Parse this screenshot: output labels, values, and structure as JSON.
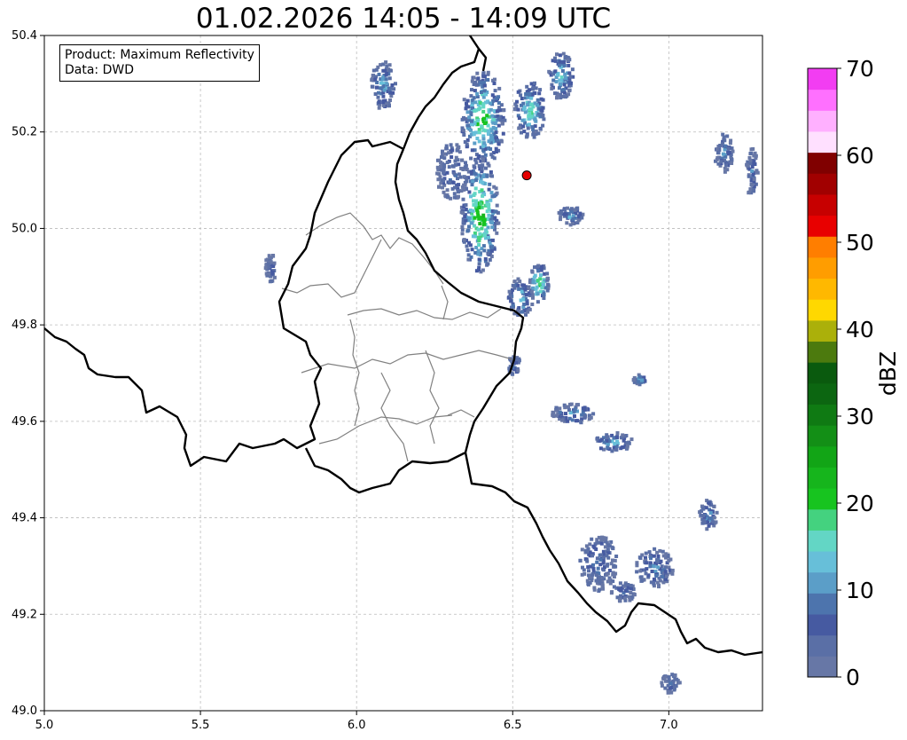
{
  "title": "01.02.2026 14:05 - 14:09 UTC",
  "info": {
    "product_line": "Product: Maximum Reflectivity",
    "data_line": "Data: DWD"
  },
  "map": {
    "lon_range": [
      5.0,
      7.3
    ],
    "lat_range": [
      49.0,
      50.4
    ],
    "x_ticks": [
      "5.0",
      "5.5",
      "6.0",
      "6.5",
      "7.0"
    ],
    "x_tick_values": [
      5.0,
      5.5,
      6.0,
      6.5,
      7.0
    ],
    "y_ticks": [
      "49.0",
      "49.2",
      "49.4",
      "49.6",
      "49.8",
      "50.0",
      "50.2",
      "50.4"
    ],
    "y_tick_values": [
      49.0,
      49.2,
      49.4,
      49.6,
      49.8,
      50.0,
      50.2,
      50.4
    ],
    "grid": true,
    "marker": {
      "lon": 6.545,
      "lat": 50.11,
      "color": "#e60000"
    },
    "border_color": "#000000",
    "district_color": "#808080",
    "gridline_color": "#bbbbbb"
  },
  "colorbar": {
    "label": "dBZ",
    "tick_labels": [
      "0",
      "10",
      "20",
      "30",
      "40",
      "50",
      "60",
      "70"
    ],
    "tick_values": [
      0,
      10,
      20,
      30,
      40,
      50,
      60,
      70
    ],
    "range": [
      0,
      70
    ],
    "colors": [
      "#6777a6",
      "#5a6fa6",
      "#465aa1",
      "#4d74ad",
      "#5b9ec8",
      "#67bfd9",
      "#63d6c5",
      "#44d27f",
      "#17c41f",
      "#16b51c",
      "#12a516",
      "#138f16",
      "#0f7a13",
      "#0c6611",
      "#0a5a0e",
      "#4c7a0e",
      "#abb00a",
      "#ffd800",
      "#ffb800",
      "#ff9d00",
      "#ff7e00",
      "#e80000",
      "#c70000",
      "#a10000",
      "#800000",
      "#ffe0ff",
      "#ffb0ff",
      "#ff70ff",
      "#f23df2"
    ]
  },
  "reflectivity_cells": [
    {
      "lon": 6.4,
      "lat": 50.23,
      "rx": 0.07,
      "ry": 0.1,
      "dbz": 22
    },
    {
      "lon": 6.39,
      "lat": 50.03,
      "rx": 0.06,
      "ry": 0.12,
      "dbz": 24
    },
    {
      "lon": 6.55,
      "lat": 50.25,
      "rx": 0.05,
      "ry": 0.06,
      "dbz": 18
    },
    {
      "lon": 6.58,
      "lat": 49.89,
      "rx": 0.03,
      "ry": 0.04,
      "dbz": 23
    },
    {
      "lon": 6.52,
      "lat": 49.86,
      "rx": 0.04,
      "ry": 0.04,
      "dbz": 15
    },
    {
      "lon": 6.65,
      "lat": 50.32,
      "rx": 0.04,
      "ry": 0.05,
      "dbz": 16
    },
    {
      "lon": 6.3,
      "lat": 50.12,
      "rx": 0.05,
      "ry": 0.06,
      "dbz": 8
    },
    {
      "lon": 6.08,
      "lat": 50.3,
      "rx": 0.04,
      "ry": 0.05,
      "dbz": 12
    },
    {
      "lon": 6.68,
      "lat": 50.03,
      "rx": 0.04,
      "ry": 0.02,
      "dbz": 12
    },
    {
      "lon": 7.17,
      "lat": 50.16,
      "rx": 0.03,
      "ry": 0.04,
      "dbz": 9
    },
    {
      "lon": 7.26,
      "lat": 50.12,
      "rx": 0.02,
      "ry": 0.05,
      "dbz": 8
    },
    {
      "lon": 6.69,
      "lat": 49.62,
      "rx": 0.07,
      "ry": 0.02,
      "dbz": 12
    },
    {
      "lon": 6.82,
      "lat": 49.56,
      "rx": 0.06,
      "ry": 0.02,
      "dbz": 14
    },
    {
      "lon": 6.77,
      "lat": 49.31,
      "rx": 0.06,
      "ry": 0.06,
      "dbz": 8
    },
    {
      "lon": 6.95,
      "lat": 49.3,
      "rx": 0.06,
      "ry": 0.04,
      "dbz": 10
    },
    {
      "lon": 6.85,
      "lat": 49.25,
      "rx": 0.04,
      "ry": 0.02,
      "dbz": 9
    },
    {
      "lon": 7.12,
      "lat": 49.41,
      "rx": 0.03,
      "ry": 0.03,
      "dbz": 12
    },
    {
      "lon": 5.72,
      "lat": 49.92,
      "rx": 0.02,
      "ry": 0.03,
      "dbz": 6
    },
    {
      "lon": 7.0,
      "lat": 49.06,
      "rx": 0.03,
      "ry": 0.02,
      "dbz": 6
    },
    {
      "lon": 6.9,
      "lat": 49.69,
      "rx": 0.02,
      "ry": 0.01,
      "dbz": 16
    },
    {
      "lon": 6.5,
      "lat": 49.72,
      "rx": 0.02,
      "ry": 0.02,
      "dbz": 8
    }
  ]
}
